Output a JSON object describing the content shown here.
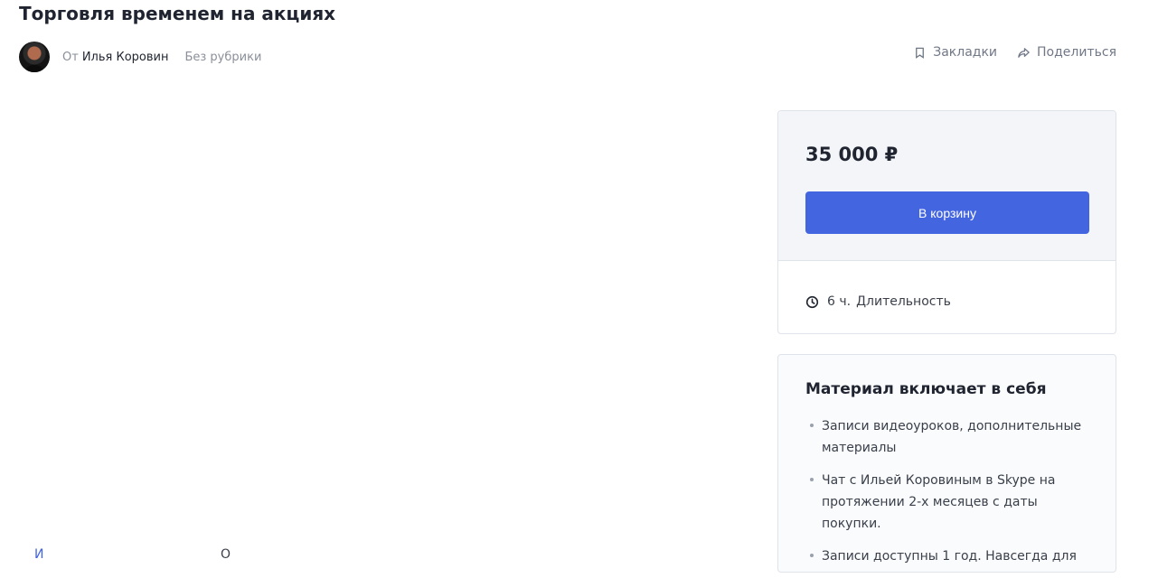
{
  "page": {
    "title": "Торговля временем на акциях"
  },
  "meta": {
    "by": "От",
    "author": "Илья Коровин",
    "category": "Без рубрики"
  },
  "actions": {
    "bookmarks": "Закладки",
    "share": "Поделиться"
  },
  "price_card": {
    "price": "35 000 ₽",
    "button": "В корзину",
    "duration_value": "6 ч.",
    "duration_label": "Длительность"
  },
  "includes": {
    "title": "Материал включает в себя",
    "items": [
      "Записи видеоуроков, дополнительные материалы",
      "Чат с Ильей Коровиным в Skype на протяжении 2-х месяцев с даты покупки.",
      "Записи доступны 1 год. Навсегда для"
    ]
  },
  "cutoff": {
    "left": "И",
    "mid": "О"
  },
  "colors": {
    "accent": "#4465e0",
    "card_bg": "#f3f5f9",
    "border": "#dfe3ea"
  },
  "icons": {
    "bookmark": "bookmark-icon",
    "share": "share-icon",
    "duration": "clock-icon"
  }
}
